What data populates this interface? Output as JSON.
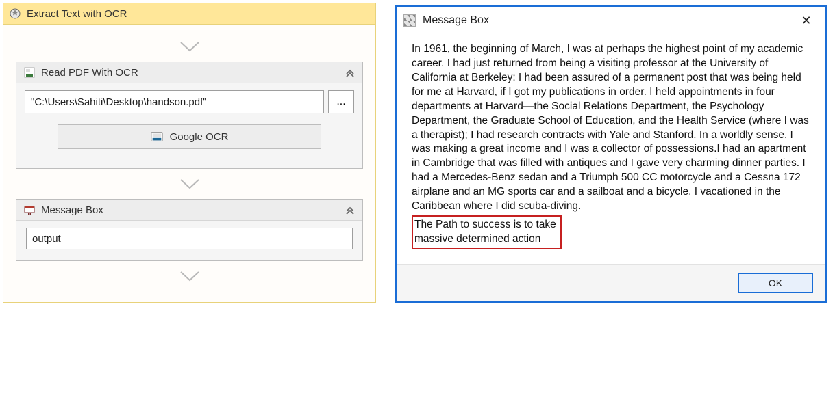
{
  "sequence": {
    "title": "Extract Text with OCR",
    "activities": {
      "readPdf": {
        "title": "Read PDF With OCR",
        "filePath": "\"C:\\Users\\Sahiti\\Desktop\\handson.pdf\"",
        "browseLabel": "...",
        "ocrEngine": "Google OCR"
      },
      "messageBox": {
        "title": "Message Box",
        "expression": "output"
      }
    }
  },
  "dialog": {
    "title": "Message Box",
    "closeGlyph": "✕",
    "bodyMain": "In 1961, the beginning of March, I was at perhaps the highest point of my academic career. I had just returned from being a visiting professor at the University of California at Berkeley: I had been assured of a permanent post that was being held for me at Harvard, if I got my publications in order. I held appointments in four departments at Harvard—the Social Relations Department, the Psychology Department, the Graduate School of Education, and the Health Service (where I was a therapist); I had research contracts with Yale and Stanford. In a worldly sense, I was making a great income and I was a collector of possessions.I had an apartment in Cambridge that was filled with antiques and I gave very charming dinner parties. I had a Mercedes-Benz sedan and a Triumph 500 CC motorcycle and a Cessna 172 airplane and an MG sports car and a sailboat and a bicycle. I vacationed in the Caribbean where I did scuba-diving.",
    "bodyHighlightLine1": "The Path to success is to take",
    "bodyHighlightLine2": "massive determined action",
    "okLabel": "OK"
  }
}
